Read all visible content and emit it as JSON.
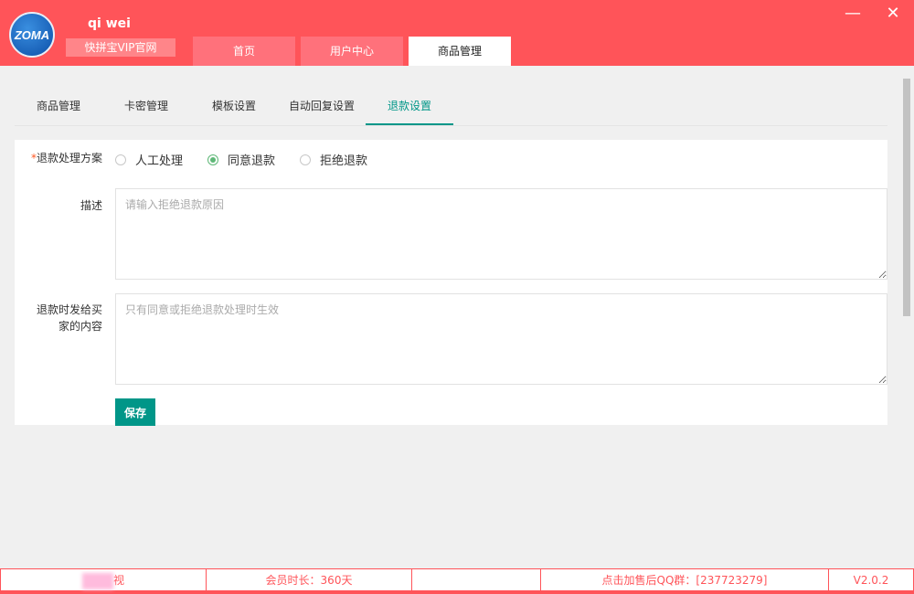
{
  "header": {
    "logo_text": "ZOMA",
    "username": "qi  wei",
    "vip_link": "快拼宝VIP官网",
    "tabs": [
      {
        "label": "首页"
      },
      {
        "label": "用户中心"
      },
      {
        "label": "商品管理"
      }
    ],
    "minimize": "—",
    "close": "✕"
  },
  "subtabs": [
    {
      "label": "商品管理"
    },
    {
      "label": "卡密管理"
    },
    {
      "label": "模板设置"
    },
    {
      "label": "自动回复设置"
    },
    {
      "label": "退款设置"
    }
  ],
  "form": {
    "scheme_label": "退款处理方案",
    "required_mark": "*",
    "options": [
      {
        "label": "人工处理",
        "checked": false
      },
      {
        "label": "同意退款",
        "checked": true
      },
      {
        "label": "拒绝退款",
        "checked": false
      }
    ],
    "desc_label": "描述",
    "desc_placeholder": "请输入拒绝退款原因",
    "msg_label": "退款时发给买家的内容",
    "msg_placeholder": "只有同意或拒绝退款处理时生效",
    "save_label": "保存"
  },
  "footer": {
    "cell1": "视",
    "membership": "会员时长：360天",
    "empty": "",
    "qq": "点击加售后QQ群：[237723279]",
    "version": "V2.0.2"
  },
  "colors": {
    "brand": "#ff5459",
    "accent": "#009688"
  }
}
